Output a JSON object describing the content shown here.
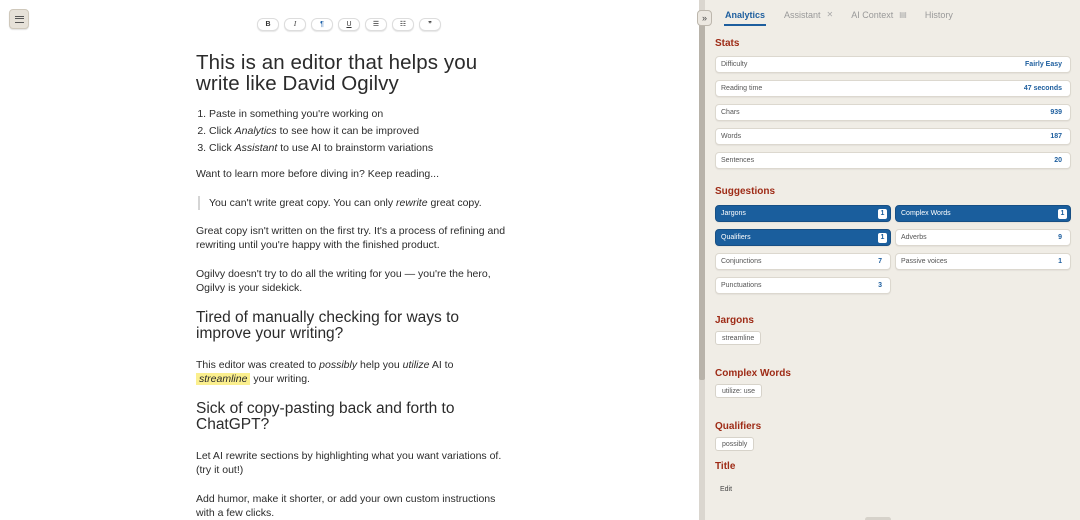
{
  "toolbar": {
    "buttons": [
      {
        "name": "bold",
        "glyph": "B"
      },
      {
        "name": "italic",
        "glyph": "I"
      },
      {
        "name": "paragraph",
        "glyph": "¶"
      },
      {
        "name": "underline",
        "glyph": "U"
      },
      {
        "name": "bullet-list",
        "glyph": "☰"
      },
      {
        "name": "ordered-list",
        "glyph": "☷"
      },
      {
        "name": "quote",
        "glyph": "❞"
      }
    ]
  },
  "doc": {
    "title": "This is an editor that helps you write like David Ogilvy",
    "steps": [
      {
        "before": "Paste in something you're working on",
        "em": "",
        "after": ""
      },
      {
        "before": "Click ",
        "em": "Analytics",
        "after": " to see how it can be improved"
      },
      {
        "before": "Click ",
        "em": "Assistant",
        "after": " to use AI to brainstorm variations"
      }
    ],
    "intro": "Want to learn more before diving in? Keep reading...",
    "quote_before": "You can't write great copy. You can only ",
    "quote_em": "rewrite",
    "quote_after": " great copy.",
    "p1": "Great copy isn't written on the first try. It's a process of refining and rewriting until you're happy with the finished product.",
    "p2": "Ogilvy doesn't try to do all the writing for you — you're the hero, Ogilvy is your sidekick.",
    "h2a": "Tired of manually checking for ways to improve your writing?",
    "p3": {
      "t1": "This editor was created to ",
      "em1": "possibly",
      "t2": " help you ",
      "em2": "utilize",
      "t3": " AI to ",
      "highlight": "streamline",
      "t4": " your writing."
    },
    "h2b": "Sick of copy-pasting back and forth to ChatGPT?",
    "p4": "Let AI rewrite sections by highlighting what you want variations of. (try it out!)",
    "p5": "Add humor, make it shorter, or add your own custom instructions with a few clicks."
  },
  "panel": {
    "collapse_glyph": "»",
    "tabs": [
      {
        "label": "Analytics",
        "icon": ""
      },
      {
        "label": "Assistant",
        "icon": "✕"
      },
      {
        "label": "AI Context",
        "icon": "▤"
      },
      {
        "label": "History",
        "icon": ""
      }
    ],
    "stats_title": "Stats",
    "stats": [
      {
        "label": "Difficulty",
        "value": "Fairly Easy"
      },
      {
        "label": "Reading time",
        "value": "47 seconds"
      },
      {
        "label": "Chars",
        "value": "939"
      },
      {
        "label": "Words",
        "value": "187"
      },
      {
        "label": "Sentences",
        "value": "20"
      }
    ],
    "suggestions_title": "Suggestions",
    "suggestions": [
      {
        "label": "Jargons",
        "count": "1",
        "active": true
      },
      {
        "label": "Complex Words",
        "count": "1",
        "active": true
      },
      {
        "label": "Qualifiers",
        "count": "1",
        "active": true
      },
      {
        "label": "Adverbs",
        "count": "9",
        "active": false
      },
      {
        "label": "Conjunctions",
        "count": "7",
        "active": false
      },
      {
        "label": "Passive voices",
        "count": "1",
        "active": false
      },
      {
        "label": "Punctuations",
        "count": "3",
        "active": false
      }
    ],
    "jargons_title": "Jargons",
    "jargons_tag": "streamline",
    "complex_title": "Complex Words",
    "complex_tag": "utilize: use",
    "qualifiers_title": "Qualifiers",
    "qualifiers_tag": "possibly",
    "title_title": "Title",
    "edit_label": "Edit"
  },
  "colors": {
    "accent": "#1a5e9d",
    "section_heading": "#9e2b16",
    "panel_bg": "#f0ede6",
    "highlight": "#fbef8e"
  }
}
